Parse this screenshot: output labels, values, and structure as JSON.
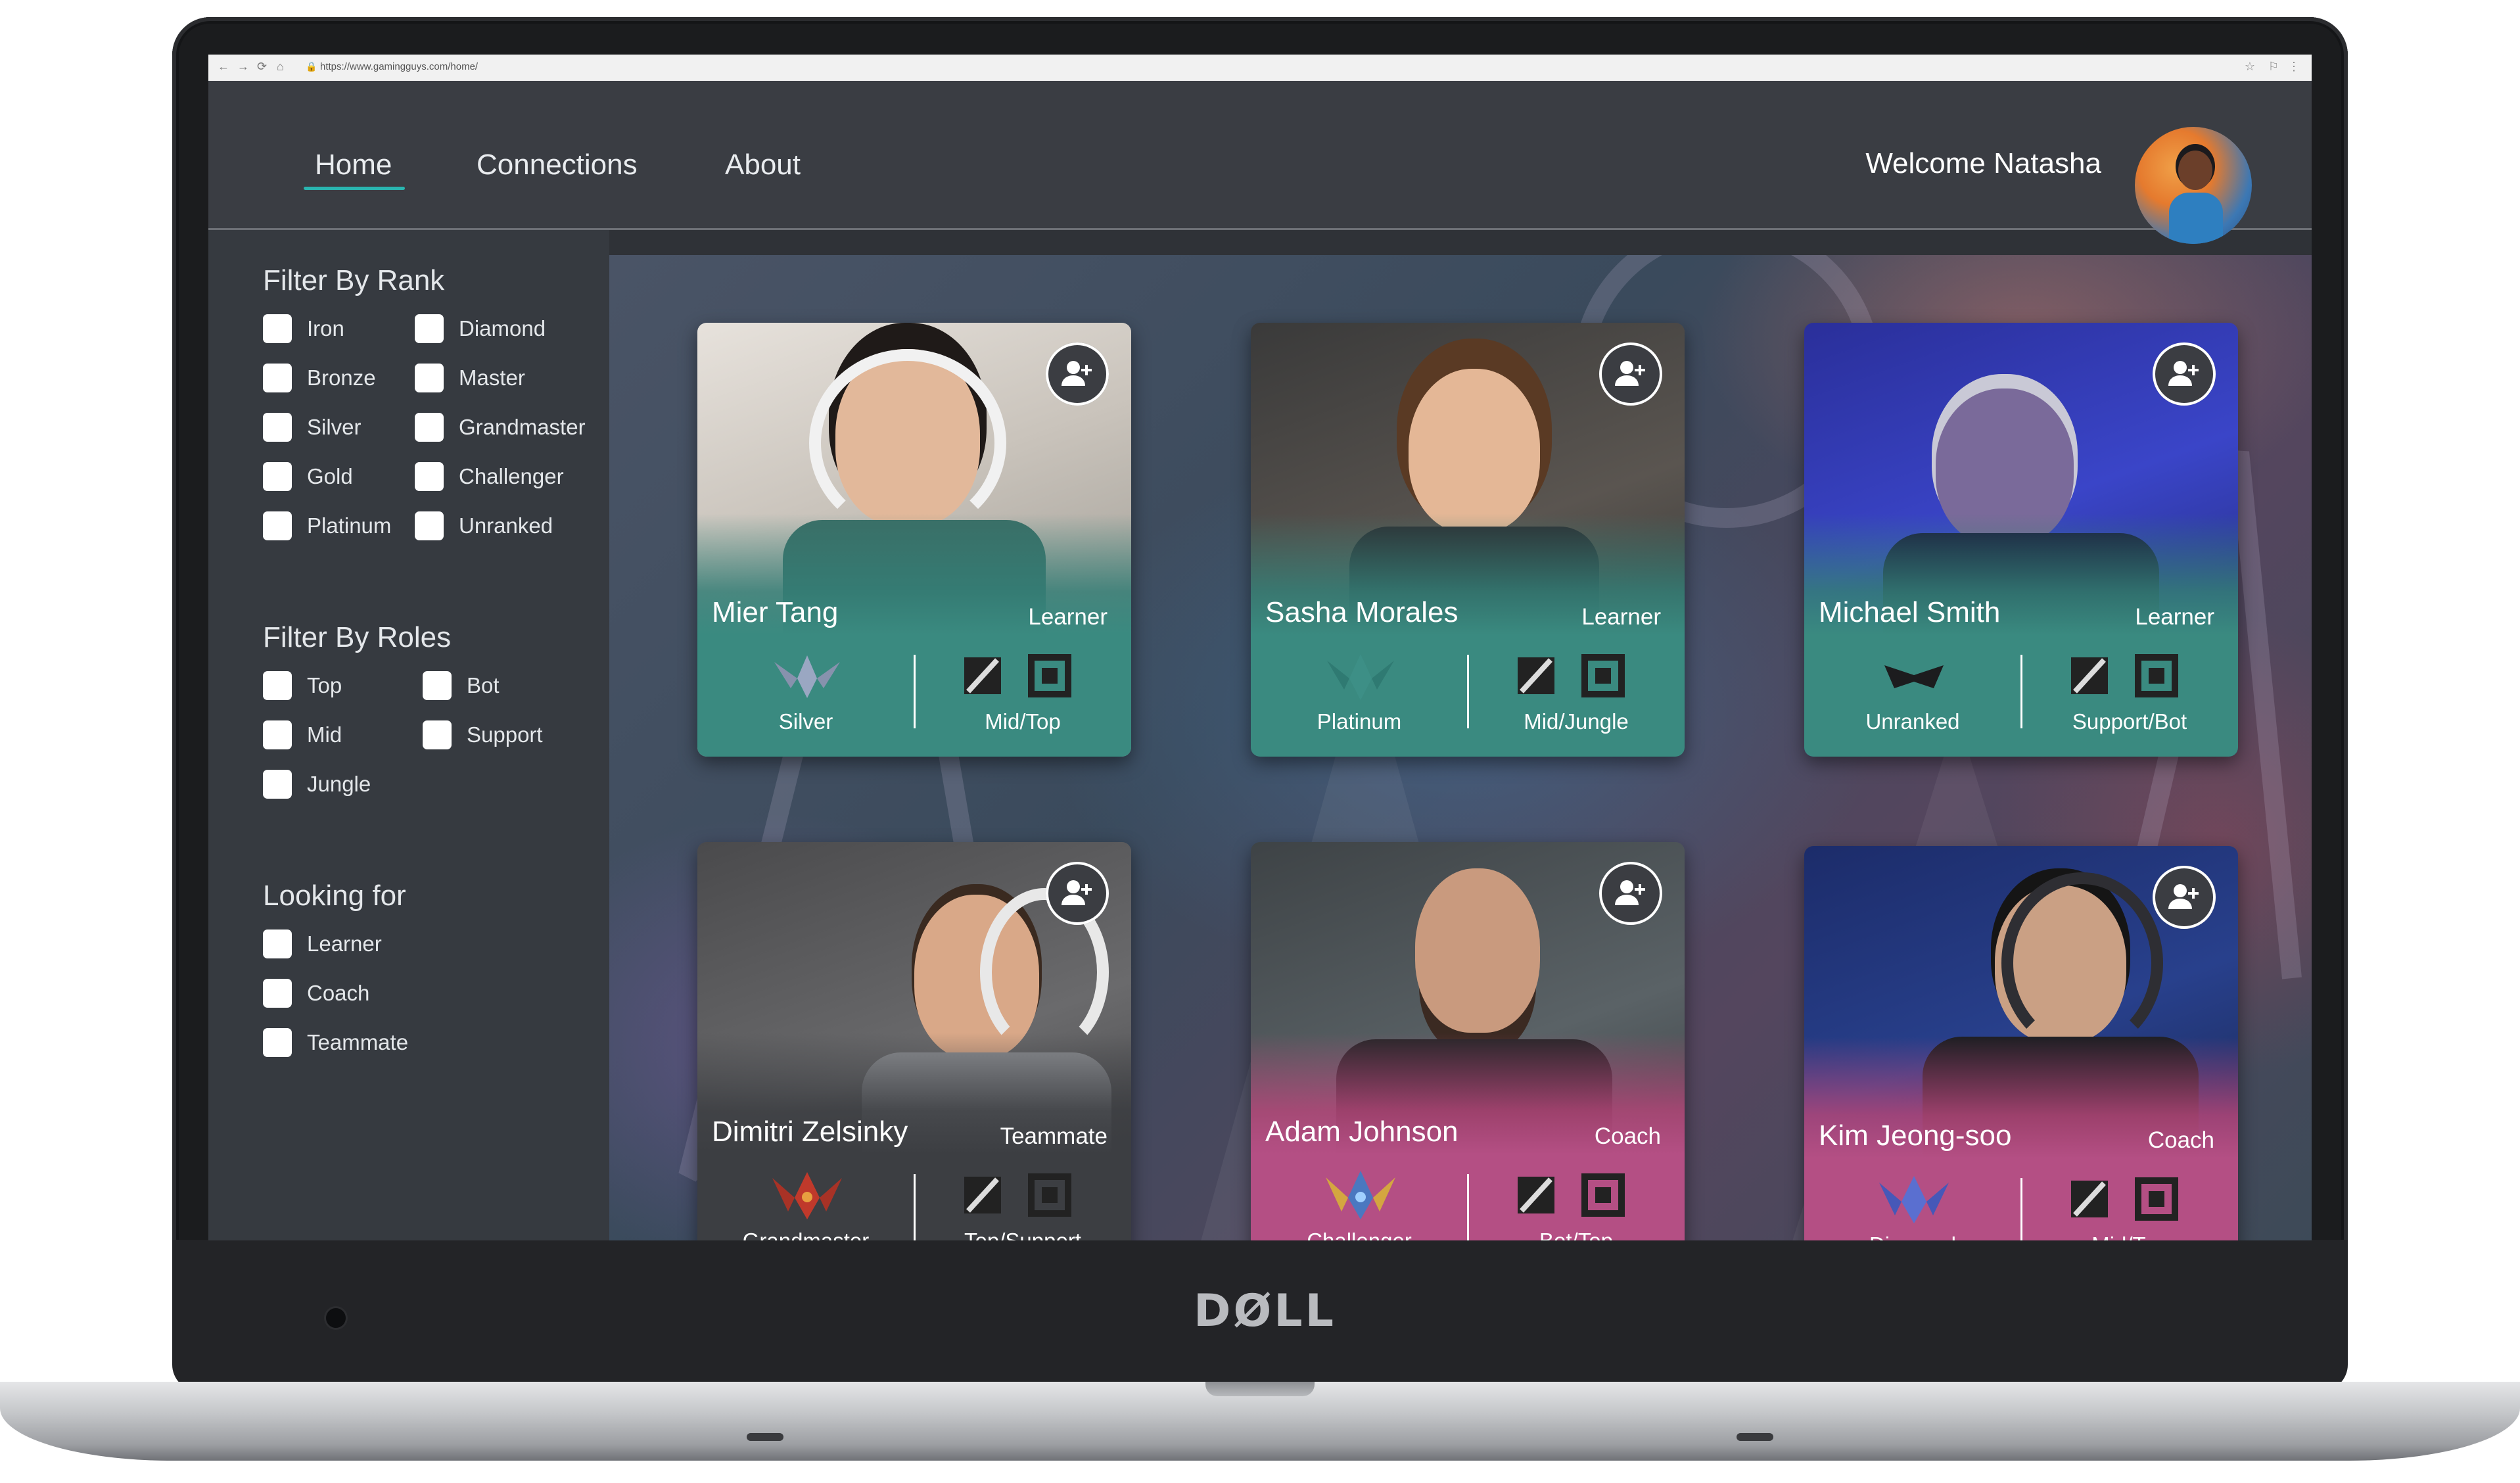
{
  "browser": {
    "url": "https://www.gamingguys.com/home/",
    "back_icon": "←",
    "forward_icon": "→",
    "reload_icon": "⟳",
    "home_icon": "⌂",
    "lock_icon": "🔒",
    "star_icon": "☆",
    "ext_icon": "⚐",
    "menu_icon": "⋮"
  },
  "brand": "DØLL",
  "nav": {
    "items": [
      {
        "label": "Home",
        "active": true
      },
      {
        "label": "Connections",
        "active": false
      },
      {
        "label": "About",
        "active": false
      }
    ],
    "accent_color": "#29b5b0"
  },
  "user": {
    "welcome": "Welcome Natasha"
  },
  "filters": {
    "rank": {
      "title": "Filter By Rank",
      "col1": [
        "Iron",
        "Bronze",
        "Silver",
        "Gold",
        "Platinum"
      ],
      "col2": [
        "Diamond",
        "Master",
        "Grandmaster",
        "Challenger",
        "Unranked"
      ]
    },
    "roles": {
      "title": "Filter By Roles",
      "col1": [
        "Top",
        "Mid",
        "Jungle"
      ],
      "col2": [
        "Bot",
        "Support"
      ]
    },
    "looking": {
      "title": "Looking for",
      "items": [
        "Learner",
        "Coach",
        "Teammate"
      ]
    }
  },
  "players": [
    {
      "name": "Mier Tang",
      "looking_for": "Learner",
      "rank": "Silver",
      "roles": "Mid/Top",
      "theme": "teal"
    },
    {
      "name": "Sasha Morales",
      "looking_for": "Learner",
      "rank": "Platinum",
      "roles": "Mid/Jungle",
      "theme": "teal"
    },
    {
      "name": "Michael Smith",
      "looking_for": "Learner",
      "rank": "Unranked",
      "roles": "Support/Bot",
      "theme": "teal"
    },
    {
      "name": "Dimitri Zelsinky",
      "looking_for": "Teammate",
      "rank": "Grandmaster",
      "roles": "Top/Support",
      "theme": "gray"
    },
    {
      "name": "Adam Johnson",
      "looking_for": "Coach",
      "rank": "Challenger",
      "roles": "Bot/Top",
      "theme": "pink"
    },
    {
      "name": "Kim Jeong-soo",
      "looking_for": "Coach",
      "rank": "Diamond",
      "roles": "Mid/Top",
      "theme": "pink"
    }
  ],
  "colors": {
    "teal_card": "#3a8a80",
    "gray_card": "#3c3e42",
    "pink_card": "#b44f84"
  }
}
